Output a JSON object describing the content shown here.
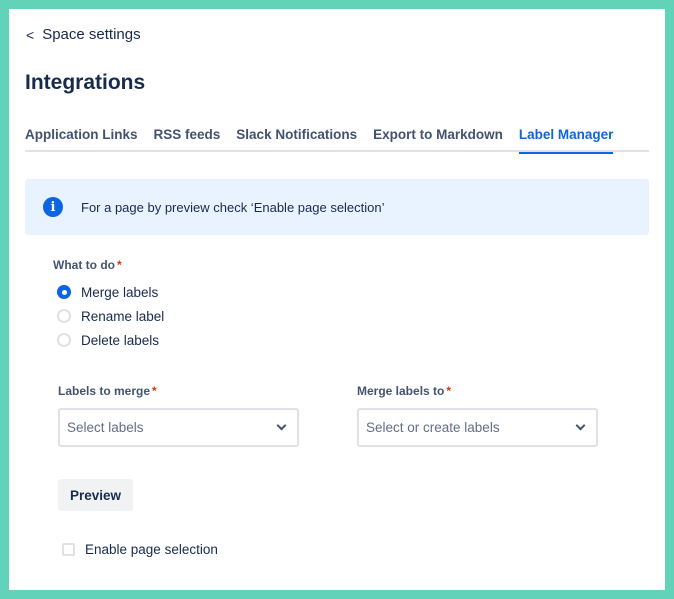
{
  "nav": {
    "back_label": "Space settings",
    "back_icon": "chevron-left-icon"
  },
  "page": {
    "title": "Integrations"
  },
  "tabs": [
    {
      "label": "Application Links",
      "active": false
    },
    {
      "label": "RSS feeds",
      "active": false
    },
    {
      "label": "Slack Notifications",
      "active": false
    },
    {
      "label": "Export to Markdown",
      "active": false
    },
    {
      "label": "Label Manager",
      "active": true
    }
  ],
  "info_banner": {
    "icon": "info-icon",
    "icon_glyph": "i",
    "text": "For a page by preview check ‘Enable page selection’"
  },
  "form": {
    "what_to_do": {
      "label": "What to do",
      "required_mark": "*",
      "options": [
        {
          "label": "Merge labels",
          "checked": true
        },
        {
          "label": "Rename label",
          "checked": false
        },
        {
          "label": "Delete labels",
          "checked": false
        }
      ]
    },
    "labels_to_merge": {
      "label": "Labels to merge",
      "required_mark": "*",
      "placeholder": "Select labels"
    },
    "merge_labels_to": {
      "label": "Merge labels to",
      "required_mark": "*",
      "placeholder": "Select or create labels"
    },
    "preview_label": "Preview",
    "enable_page_selection": {
      "label": "Enable page selection",
      "checked": false
    }
  },
  "colors": {
    "frame": "#62d2b9",
    "accent": "#0c66e4",
    "info_bg": "#e9f2ff",
    "required": "#de350b",
    "text": "#172b4d"
  }
}
